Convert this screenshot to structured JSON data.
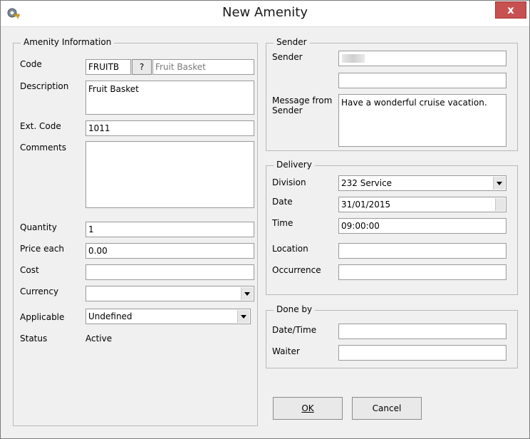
{
  "window": {
    "title": "New Amenity",
    "close_label": "x",
    "app_icon": "gear-key-icon"
  },
  "amenity": {
    "legend": "Amenity Information",
    "code_label": "Code",
    "code_value": "FRUITB",
    "lookup_label": "?",
    "code_desc": "Fruit Basket",
    "description_label": "Description",
    "description_value": "Fruit Basket",
    "ext_code_label": "Ext. Code",
    "ext_code_value": "1011",
    "comments_label": "Comments",
    "comments_value": "",
    "quantity_label": "Quantity",
    "quantity_value": "1",
    "price_label": "Price each",
    "price_value": "0.00",
    "cost_label": "Cost",
    "cost_value": "",
    "currency_label": "Currency",
    "currency_value": "",
    "applicable_label": "Applicable",
    "applicable_value": "Undefined",
    "status_label": "Status",
    "status_value": "Active"
  },
  "sender": {
    "legend": "Sender",
    "sender_label": "Sender",
    "sender_line2": "",
    "message_label": "Message from Sender",
    "message_value": "Have a wonderful cruise vacation."
  },
  "delivery": {
    "legend": "Delivery",
    "division_label": "Division",
    "division_value": "232 Service",
    "date_label": "Date",
    "date_value": "31/01/2015",
    "time_label": "Time",
    "time_value": "09:00:00",
    "location_label": "Location",
    "location_value": "",
    "occurrence_label": "Occurrence",
    "occurrence_value": ""
  },
  "doneby": {
    "legend": "Done by",
    "datetime_label": "Date/Time",
    "datetime_value": "",
    "waiter_label": "Waiter",
    "waiter_value": ""
  },
  "buttons": {
    "ok_label": "OK",
    "cancel_label": "Cancel"
  }
}
